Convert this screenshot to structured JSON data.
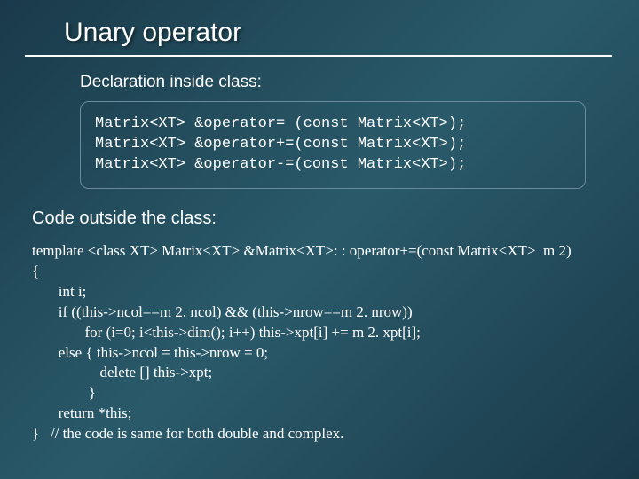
{
  "title": "Unary operator",
  "declaration_label": "Declaration inside class:",
  "declaration_lines": [
    "Matrix<XT> &operator= (const Matrix<XT>);",
    "Matrix<XT> &operator+=(const Matrix<XT>);",
    "Matrix<XT> &operator-=(const Matrix<XT>);"
  ],
  "outside_label": "Code outside the class:",
  "code_lines": [
    "template <class XT> Matrix<XT> &Matrix<XT>: : operator+=(const Matrix<XT>  m 2)",
    "{",
    "       int i;",
    "       if ((this->ncol==m 2. ncol) && (this->nrow==m 2. nrow))",
    "              for (i=0; i<this->dim(); i++) this->xpt[i] += m 2. xpt[i];",
    "       else { this->ncol = this->nrow = 0;",
    "                  delete [] this->xpt;",
    "               }",
    "       return *this;",
    "}   // the code is same for both double and complex."
  ]
}
